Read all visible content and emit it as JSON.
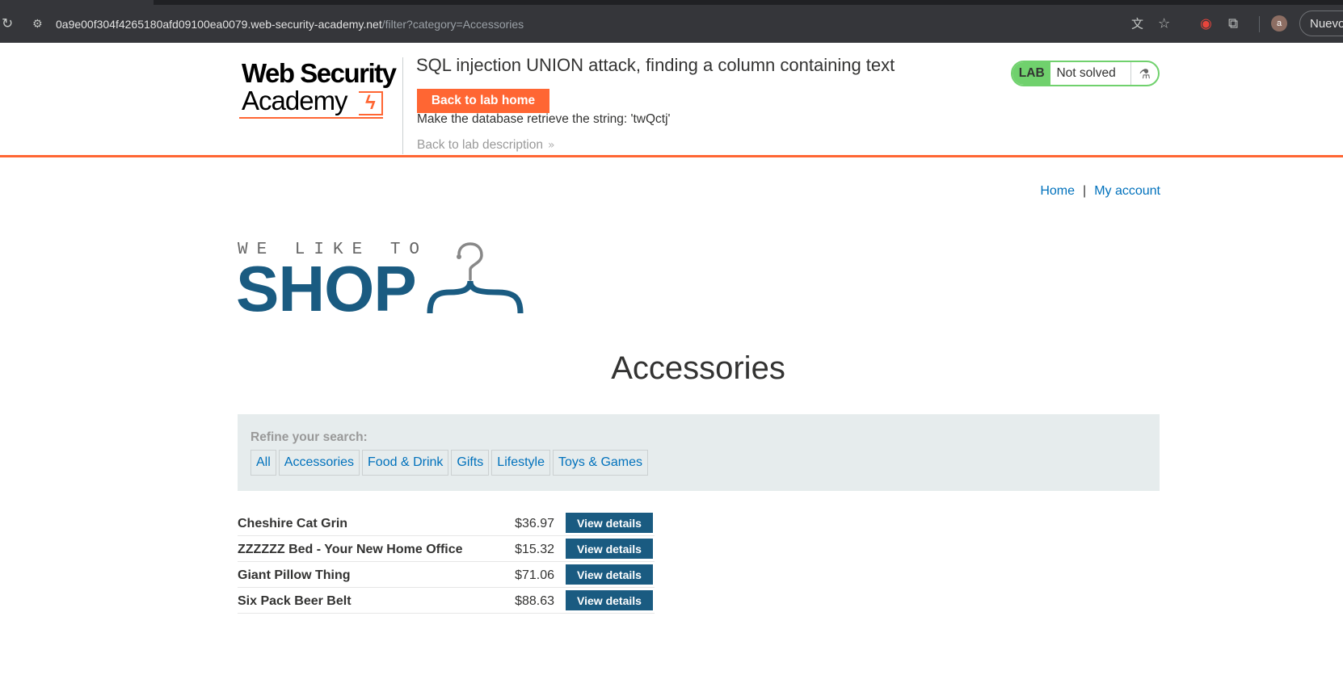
{
  "browser": {
    "url_host": "0a9e00f304f4265180afd09100ea0079.web-security-academy.net",
    "url_path": "/filter?category=Accessories",
    "profile_initial": "a",
    "profile_label": "Nuevo",
    "icons": [
      "reload-icon",
      "site-settings-icon",
      "translate-icon",
      "bookmark-star-icon",
      "extension-warning-icon",
      "extensions-puzzle-icon"
    ]
  },
  "lab": {
    "logo_line1": "Web Security",
    "logo_line2": "Academy",
    "title": "SQL injection UNION attack, finding a column containing text",
    "back_home_label": "Back to lab home",
    "goal": "Make the database retrieve the string: 'twQctj'",
    "back_description_label": "Back to lab description",
    "status_tag": "LAB",
    "status_text": "Not solved",
    "accent_color": "#ff6633",
    "status_color": "#70d16d"
  },
  "nav": {
    "home_label": "Home",
    "separator": "|",
    "account_label": "My account"
  },
  "shop_logo": {
    "tagline": "WE LIKE TO",
    "word": "SHOP",
    "brand_color": "#1a5b81"
  },
  "page": {
    "heading": "Accessories"
  },
  "filters": {
    "label": "Refine your search:",
    "items": [
      "All",
      "Accessories",
      "Food & Drink",
      "Gifts",
      "Lifestyle",
      "Toys & Games"
    ]
  },
  "products": [
    {
      "name": "Cheshire Cat Grin",
      "price": "$36.97",
      "button": "View details"
    },
    {
      "name": "ZZZZZZ Bed - Your New Home Office",
      "price": "$15.32",
      "button": "View details"
    },
    {
      "name": "Giant Pillow Thing",
      "price": "$71.06",
      "button": "View details"
    },
    {
      "name": "Six Pack Beer Belt",
      "price": "$88.63",
      "button": "View details"
    }
  ]
}
